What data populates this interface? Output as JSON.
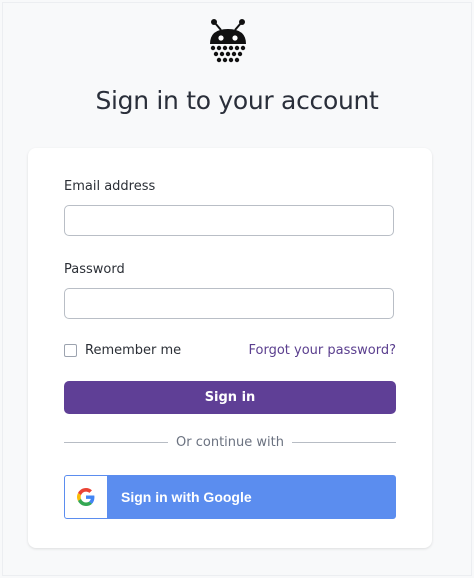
{
  "header": {
    "logo_icon": "bug-robot-logo-icon",
    "title": "Sign in to your account"
  },
  "form": {
    "email_label": "Email address",
    "email_value": "",
    "password_label": "Password",
    "password_value": "",
    "remember_label": "Remember me",
    "remember_checked": false,
    "forgot_link": "Forgot your password?",
    "signin_button": "Sign in",
    "divider_text": "Or continue with",
    "google_button": "Sign in with Google",
    "google_icon": "google-g-icon"
  },
  "colors": {
    "primary": "#5f3f96",
    "link": "#5a3e8e",
    "google_blue": "#5b8def",
    "background": "#f8f9fa"
  }
}
